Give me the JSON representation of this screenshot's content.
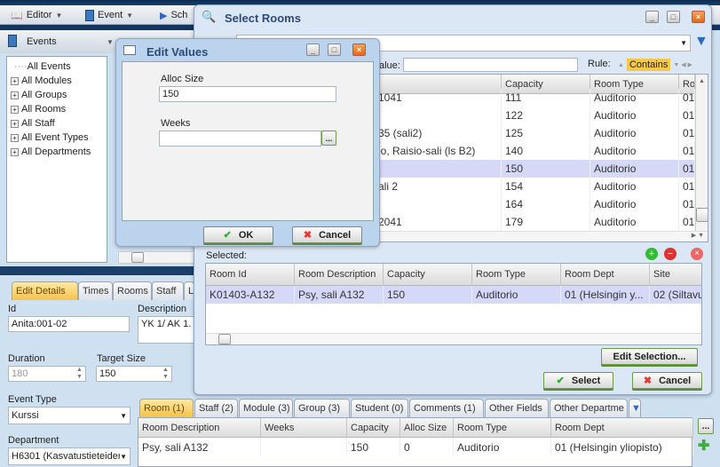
{
  "toolbar": {
    "editor": "Editor",
    "event": "Event",
    "schedule": "Sch"
  },
  "events_panel": {
    "title": "Events",
    "tree": [
      "All Events",
      "All Modules",
      "All Groups",
      "All Rooms",
      "All Staff",
      "All Event Types",
      "All Departments"
    ]
  },
  "select_rooms": {
    "title": "Select Rooms",
    "filter": {
      "value_label": "alue:",
      "value": "",
      "rule_label": "Rule:",
      "rule": "Contains"
    },
    "columns": [
      "Capacity",
      "Room Type",
      "Ro"
    ],
    "rows": [
      {
        "desc": "1041",
        "capacity": "111",
        "type": "Auditorio",
        "ro": "01"
      },
      {
        "desc": "",
        "capacity": "122",
        "type": "Auditorio",
        "ro": "01"
      },
      {
        "desc": "35 (sali2)",
        "capacity": "125",
        "type": "Auditorio",
        "ro": "01"
      },
      {
        "desc": "lo, Raisio-sali (ls B2)",
        "capacity": "140",
        "type": "Auditorio",
        "ro": "01"
      },
      {
        "desc": "",
        "capacity": "150",
        "type": "Auditorio",
        "ro": "01"
      },
      {
        "desc": "ali 2",
        "capacity": "154",
        "type": "Auditorio",
        "ro": "01"
      },
      {
        "desc": "",
        "capacity": "164",
        "type": "Auditorio",
        "ro": "01"
      },
      {
        "desc": "2041",
        "capacity": "179",
        "type": "Auditorio",
        "ro": "01"
      }
    ],
    "selected_index": 4,
    "selected_label": "Selected:",
    "selected_columns": [
      "Room Id",
      "Room Description",
      "Capacity",
      "Room Type",
      "Room Dept",
      "Site"
    ],
    "selected_rows": [
      [
        "K01403-A132",
        "Psy, sali A132",
        "150",
        "Auditorio",
        "01 (Helsingin y...",
        "02 (Siltavuo"
      ]
    ],
    "edit_selection": "Edit Selection...",
    "select": "Select",
    "cancel": "Cancel"
  },
  "edit_values": {
    "title": "Edit Values",
    "alloc_label": "Alloc Size",
    "alloc_value": "150",
    "weeks_label": "Weeks",
    "weeks_value": "",
    "browse": "...",
    "ok": "OK",
    "cancel": "Cancel"
  },
  "details": {
    "tabs": [
      "Edit Details",
      "Times",
      "Rooms",
      "Staff",
      "L"
    ],
    "id_label": "Id",
    "id": "Anita:001-02",
    "desc_label": "Description",
    "desc": "YK 1/ AK 1.",
    "duration_label": "Duration",
    "duration": "180",
    "target_label": "Target Size",
    "target": "150",
    "event_type_label": "Event Type",
    "event_type": "Kurssi",
    "dept_label": "Department",
    "dept": "H6301 (Kasvatustieteider"
  },
  "bottom": {
    "tabs": [
      "Room (1)",
      "Staff (2)",
      "Module (3)",
      "Group (3)",
      "Student (0)",
      "Comments (1)",
      "Other Fields",
      "Other Departme"
    ],
    "columns": [
      "Room Description",
      "Weeks",
      "Capacity",
      "Alloc Size",
      "Room Type",
      "Room Dept"
    ],
    "rows": [
      [
        "Psy, sali A132",
        "",
        "150",
        "0",
        "Auditorio",
        "01 (Helsingin yliopisto)"
      ]
    ],
    "more": "..."
  }
}
